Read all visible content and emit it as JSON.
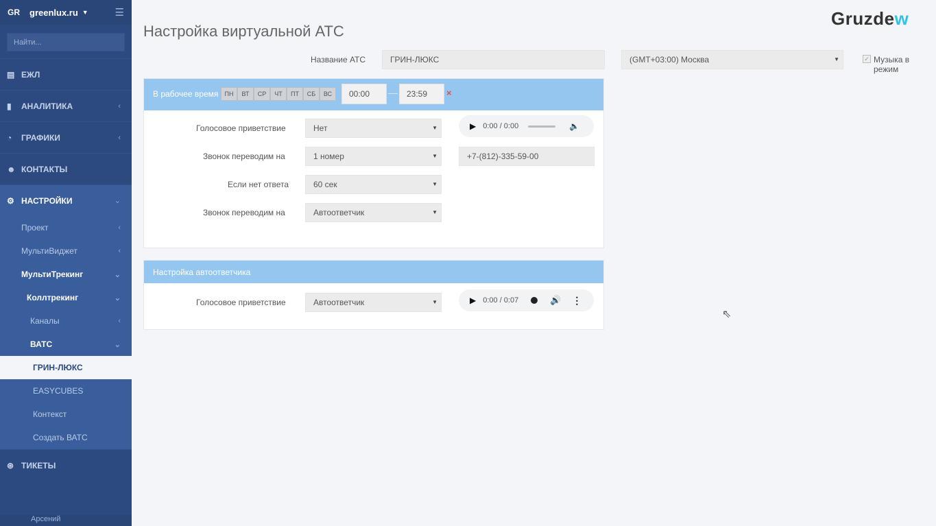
{
  "sidebar": {
    "badge": "GR",
    "site": "greenlux.ru",
    "search_placeholder": "Найти...",
    "menu": {
      "ezhl": "ЕЖЛ",
      "analytics": "АНАЛИТИКА",
      "charts": "ГРАФИКИ",
      "contacts": "КОНТАКТЫ",
      "settings": "НАСТРОЙКИ",
      "project": "Проект",
      "multiwidget": "МультиВиджет",
      "multitracking": "МультиТрекинг",
      "calltracking": "Коллтрекинг",
      "channels": "Каналы",
      "vats": "ВАТС",
      "green_lux": "ГРИН-ЛЮКС",
      "easycubes": "EASYCUBES",
      "context": "Контекст",
      "create_vats": "Создать ВАТС",
      "tickets": "ТИКЕТЫ"
    },
    "user": "Арсений"
  },
  "header": {
    "logo_main": "Gruzde",
    "logo_accent": "w",
    "title": "Настройка виртуальной АТС"
  },
  "form": {
    "ats_name_label": "Название АТС",
    "ats_name_value": "ГРИН-ЛЮКС",
    "timezone": "(GMT+03:00) Москва",
    "music_label": "Музыка в режим"
  },
  "work_time": {
    "title": "В рабочее время",
    "days": [
      "ПН",
      "ВТ",
      "СР",
      "ЧТ",
      "ПТ",
      "СБ",
      "ВС"
    ],
    "from": "00:00",
    "to": "23:59",
    "dash": "—",
    "remove": "×",
    "greeting_label": "Голосовое приветствие",
    "greeting_value": "Нет",
    "forward_label": "Звонок переводим на",
    "forward_value": "1 номер",
    "phone": "+7-(812)-335-59-00",
    "no_answer_label": "Если нет ответа",
    "no_answer_value": "60 сек",
    "forward2_label": "Звонок переводим на",
    "forward2_value": "Автоответчик",
    "audio_time": "0:00 / 0:00"
  },
  "autoresponder": {
    "title": "Настройка автоответчика",
    "greeting_label": "Голосовое приветствие",
    "greeting_value": "Автоответчик",
    "audio_time": "0:00 / 0:07"
  }
}
